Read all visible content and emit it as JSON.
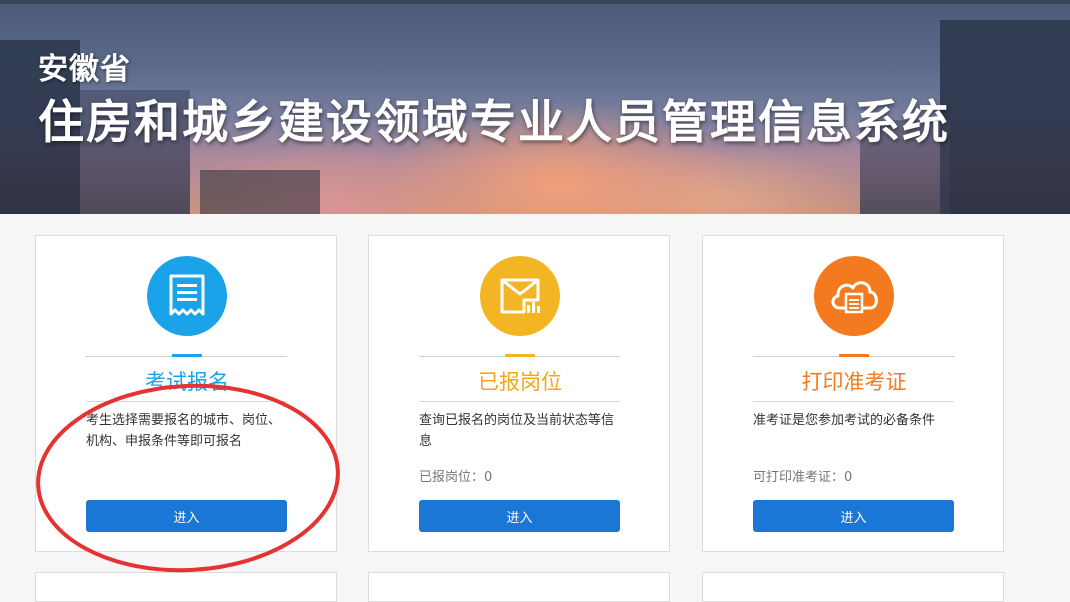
{
  "header": {
    "province": "安徽省",
    "title": "住房和城乡建设领域专业人员管理信息系统"
  },
  "colors": {
    "blue": "#1aa3e8",
    "yellow": "#f4b524",
    "orange": "#f47a20",
    "button": "#1a77d6",
    "annotation": "#e53232"
  },
  "cards": [
    {
      "icon": "receipt-icon",
      "title": "考试报名",
      "description": "考生选择需要报名的城市、岗位、机构、申报条件等即可报名",
      "stat": "",
      "button": "进入"
    },
    {
      "icon": "mail-chart-icon",
      "title": "已报岗位",
      "description": "查询已报名的岗位及当前状态等信息",
      "stat": "已报岗位：0",
      "button": "进入"
    },
    {
      "icon": "cloud-print-icon",
      "title": "打印准考证",
      "description": "准考证是您参加考试的必备条件",
      "stat": "可打印准考证：0",
      "button": "进入"
    }
  ]
}
